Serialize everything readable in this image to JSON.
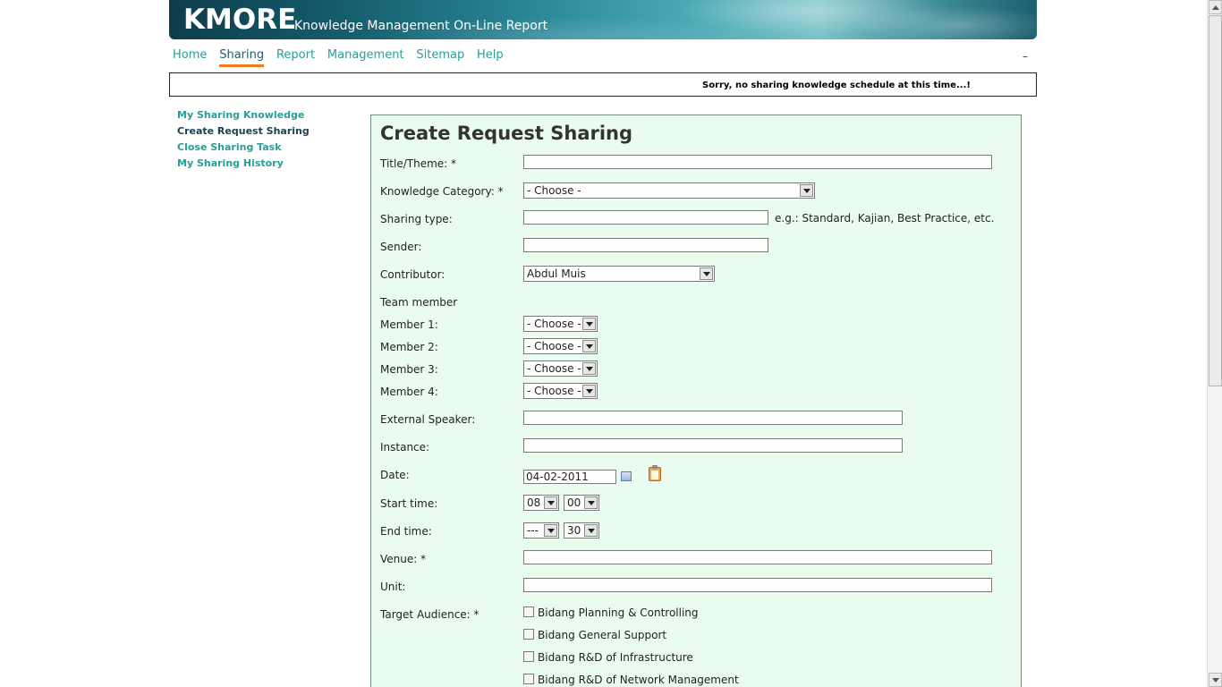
{
  "banner": {
    "brand": "KMORE",
    "subtitle": "Knowledge Management On-Line Report"
  },
  "nav": {
    "items": [
      "Home",
      "Sharing",
      "Report",
      "Management",
      "Sitemap",
      "Help"
    ],
    "active": "Sharing",
    "right_text": "–"
  },
  "notice": {
    "text": "Sorry, no sharing knowledge schedule at this time...!"
  },
  "sidebar": {
    "items": [
      "My Sharing Knowledge",
      "Create Request Sharing",
      "Close Sharing Task",
      "My Sharing History"
    ],
    "current": "Create Request Sharing"
  },
  "form": {
    "title": "Create Request Sharing",
    "labels": {
      "title_theme": "Title/Theme: *",
      "knowledge_category": "Knowledge Category: *",
      "sharing_type": "Sharing type:",
      "sender": "Sender:",
      "contributor": "Contributor:",
      "team_member": "Team member",
      "member1": "Member 1:",
      "member2": "Member 2:",
      "member3": "Member 3:",
      "member4": "Member 4:",
      "external_speaker": "External Speaker:",
      "instance": "Instance:",
      "date": "Date:",
      "start_time": "Start time:",
      "end_time": "End time:",
      "venue": "Venue: *",
      "unit": "Unit:",
      "target_audience": "Target Audience: *"
    },
    "values": {
      "knowledge_category": "- Choose -",
      "sharing_type_hint": "e.g.: Standard, Kajian, Best Practice, etc.",
      "contributor": "Abdul Muis",
      "member1": "- Choose -",
      "member2": "- Choose -",
      "member3": "- Choose -",
      "member4": "- Choose -",
      "date": "04-02-2011",
      "start_hour": "08",
      "start_minute": "00",
      "end_hour": "---",
      "end_minute": "30"
    },
    "audience": [
      "Bidang Planning & Controlling",
      "Bidang General Support",
      "Bidang R&D of Infrastructure",
      "Bidang R&D of Network Management"
    ]
  }
}
